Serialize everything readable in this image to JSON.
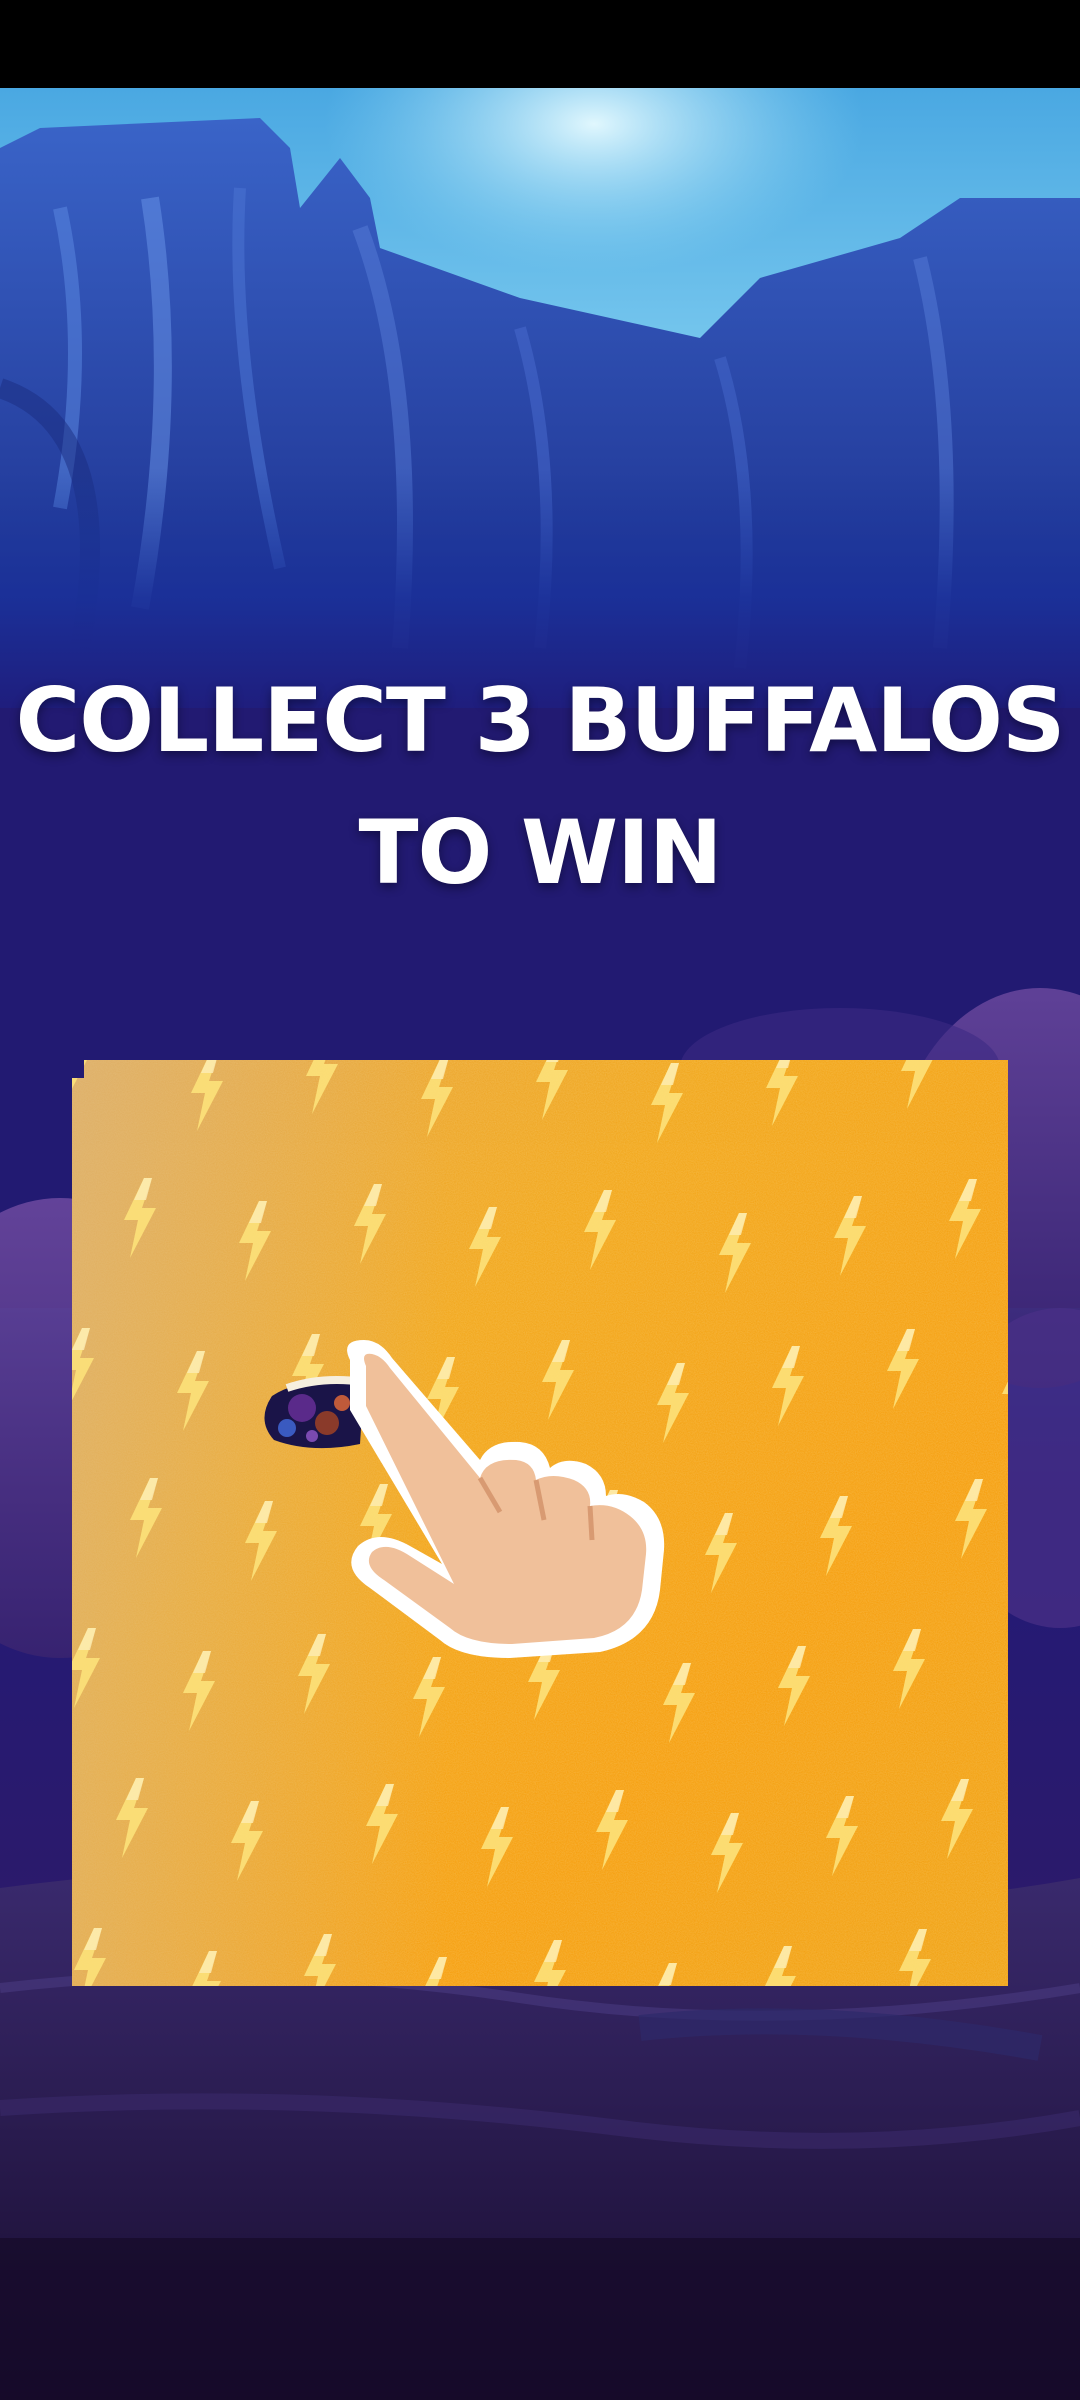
{
  "headline": {
    "line1": "COLLECT 3 BUFFALOS",
    "line2": "TO WIN"
  },
  "scratch_card": {
    "surface_color": "#f4a41c",
    "bolt_color": "#fde27a",
    "icon": "lightning-bolt-icon"
  },
  "hint": {
    "icon": "hand-pointer-icon",
    "gesture": "scratch"
  },
  "colors": {
    "sky": "#6fc4ee",
    "mountain": "#2a4aa8",
    "night": "#241a66",
    "ground": "#2a1848"
  }
}
